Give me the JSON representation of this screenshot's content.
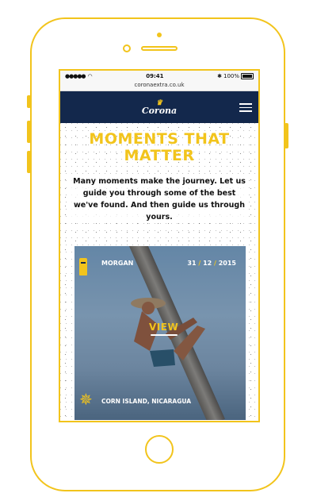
{
  "status": {
    "signal": "●●●●●",
    "time": "09:41",
    "bluetooth": "✱",
    "battery": "100%"
  },
  "browser": {
    "url": "coronaextra.co.uk"
  },
  "nav": {
    "logo_text": "Corona",
    "logo_icon": "crown-icon",
    "menu_icon": "hamburger-menu-icon"
  },
  "page": {
    "title_line1": "MOMENTS THAT",
    "title_line2": "MATTER",
    "intro": "Many moments make the journey. Let us guide you through some of the best we've found. And then guide us through yours."
  },
  "card": {
    "name": "MORGAN",
    "date_day": "31",
    "date_month": "12",
    "date_year": "2015",
    "date_sep": "/",
    "view_label": "VIEW",
    "location": "CORN ISLAND, NICARAGUA",
    "badge_icon": "tiki-statue-icon",
    "location_icon": "compass-star-icon"
  },
  "colors": {
    "accent": "#f2c41c",
    "navy": "#13284c"
  }
}
